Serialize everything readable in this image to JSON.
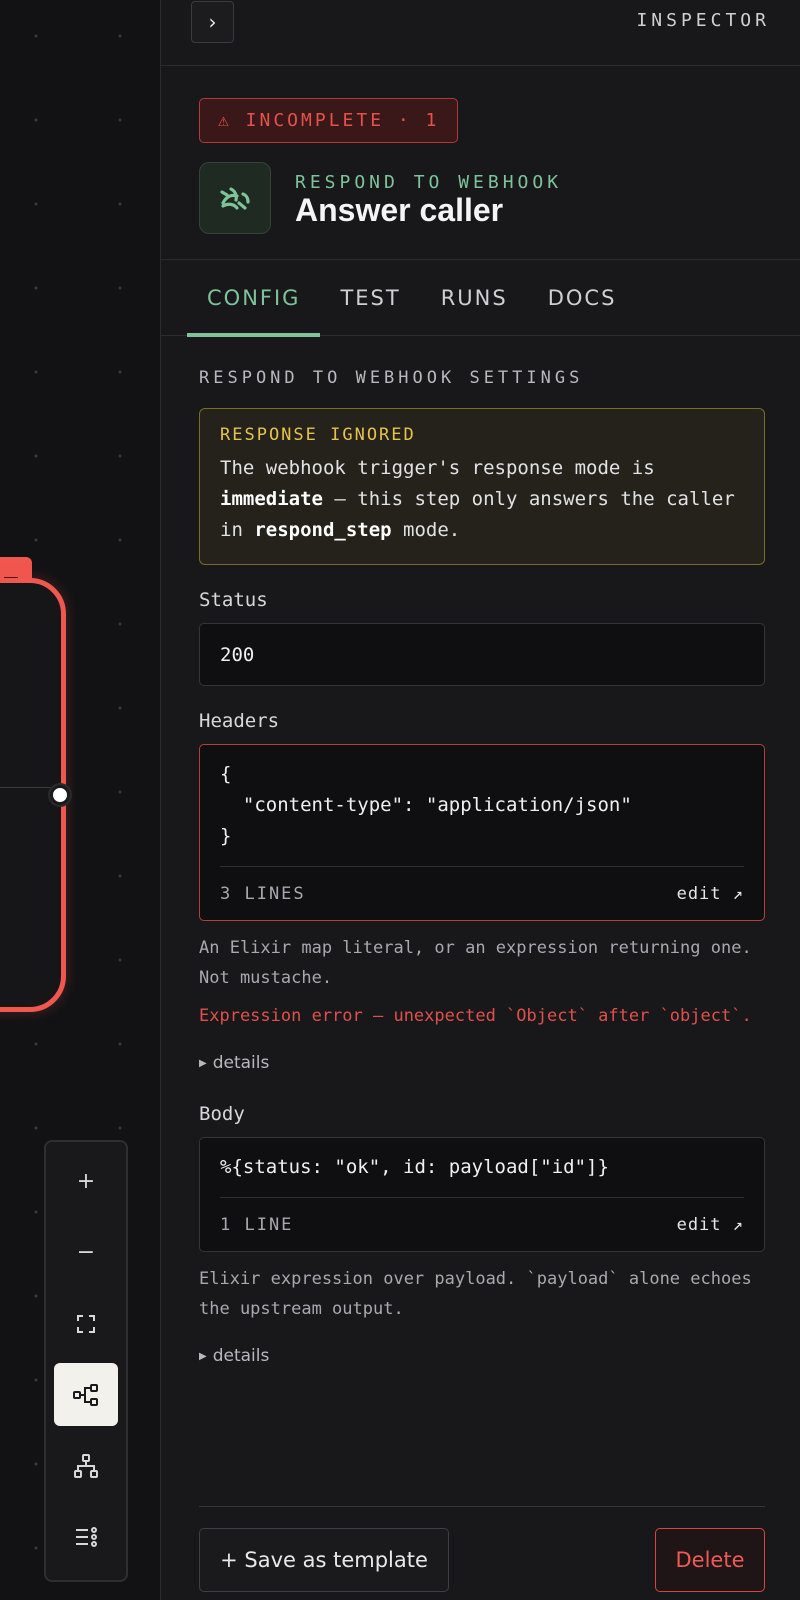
{
  "canvas": {
    "toolbar": {
      "zoom_in": "+",
      "zoom_out": "−",
      "fit_view": "⛶"
    }
  },
  "header": {
    "collapse_label": "›",
    "title": "INSPECTOR"
  },
  "step": {
    "badge": "⚠ INCOMPLETE · 1",
    "type": "RESPOND TO WEBHOOK",
    "name": "Answer caller",
    "icon": "webhook-icon"
  },
  "tabs": [
    {
      "label": "CONFIG",
      "active": true
    },
    {
      "label": "TEST",
      "active": false
    },
    {
      "label": "RUNS",
      "active": false
    },
    {
      "label": "DOCS",
      "active": false
    }
  ],
  "settings": {
    "section_title": "RESPOND TO WEBHOOK SETTINGS",
    "warning": {
      "title": "RESPONSE IGNORED",
      "text_1": "The webhook trigger's response mode is ",
      "bold_1": "immediate",
      "text_2": " — this step only answers the caller in ",
      "bold_2": "respond_step",
      "text_3": " mode."
    },
    "status": {
      "label": "Status",
      "value": "200"
    },
    "headers": {
      "label": "Headers",
      "lines": [
        "{",
        "  \"content-type\": \"application/json\"",
        "}"
      ],
      "line_count": "3 LINES",
      "edit": "edit ↗",
      "help": "An Elixir map literal, or an expression returning one. Not mustache.",
      "error": "Expression error — unexpected `Object` after `object`.",
      "details": "details"
    },
    "body": {
      "label": "Body",
      "lines": [
        "%{status: \"ok\", id: payload[\"id\"]}"
      ],
      "line_count": "1 LINE",
      "edit": "edit ↗",
      "help": "Elixir expression over payload. `payload` alone echoes the upstream output.",
      "details": "details"
    }
  },
  "footer": {
    "save_template": "+ Save as template",
    "delete": "Delete"
  },
  "colors": {
    "accent_green": "#7ec49a",
    "error_red": "#e0504a",
    "warning_yellow": "#e6c34c"
  }
}
